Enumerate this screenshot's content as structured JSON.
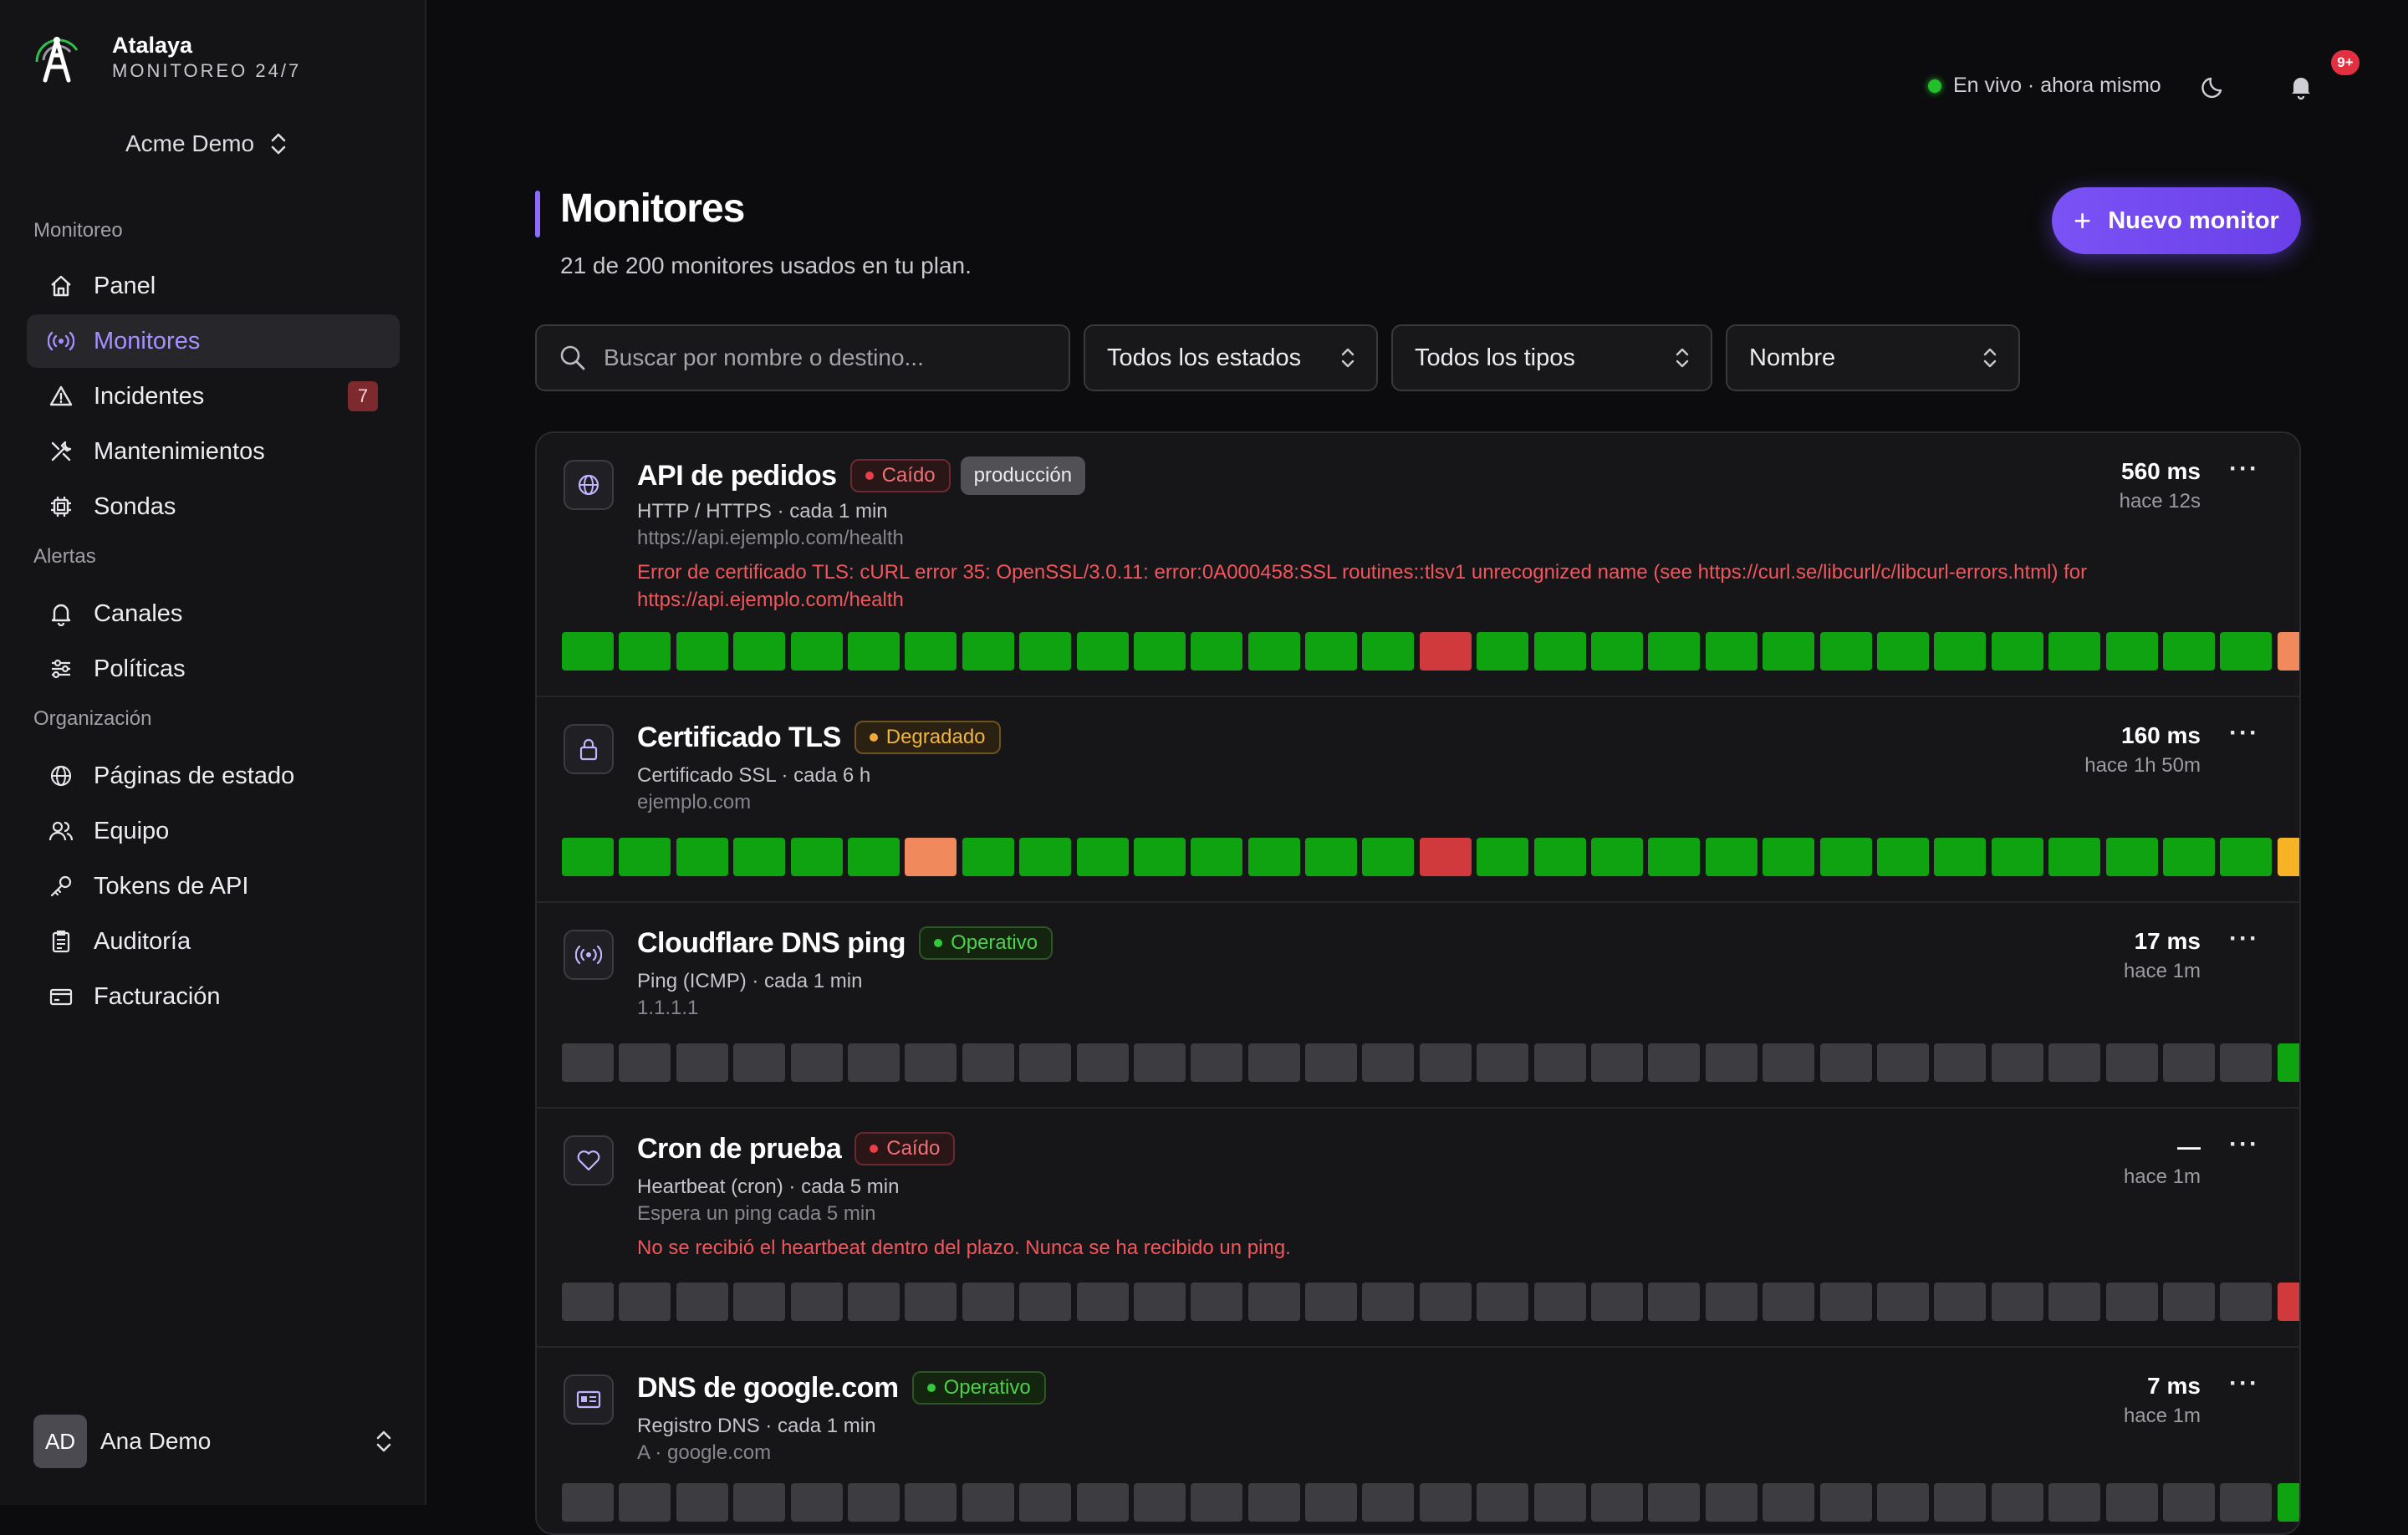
{
  "brand": {
    "name": "Atalaya",
    "subtitle": "MONITOREO 24/7"
  },
  "org": {
    "name": "Acme Demo"
  },
  "sidebar": {
    "sections": [
      {
        "label": "Monitoreo"
      },
      {
        "label": "Alertas"
      },
      {
        "label": "Organización"
      }
    ],
    "items": [
      {
        "label": "Panel",
        "icon": "home-icon"
      },
      {
        "label": "Monitores",
        "icon": "radio-icon",
        "active": true
      },
      {
        "label": "Incidentes",
        "icon": "warning-icon",
        "badge": "7"
      },
      {
        "label": "Mantenimientos",
        "icon": "tools-icon"
      },
      {
        "label": "Sondas",
        "icon": "chip-icon"
      },
      {
        "label": "Canales",
        "icon": "bell-icon"
      },
      {
        "label": "Políticas",
        "icon": "sliders-icon"
      },
      {
        "label": "Páginas de estado",
        "icon": "globe-icon"
      },
      {
        "label": "Equipo",
        "icon": "users-icon"
      },
      {
        "label": "Tokens de API",
        "icon": "key-icon"
      },
      {
        "label": "Auditoría",
        "icon": "clipboard-icon"
      },
      {
        "label": "Facturación",
        "icon": "card-icon"
      }
    ]
  },
  "user": {
    "initials": "AD",
    "name": "Ana Demo"
  },
  "topbar": {
    "live_text": "En vivo · ahora mismo",
    "notif_badge": "9+"
  },
  "page": {
    "title": "Monitores",
    "subtitle": "21 de 200 monitores usados en tu plan.",
    "new_button": "Nuevo monitor"
  },
  "filters": {
    "search_placeholder": "Buscar por nombre o destino...",
    "status": "Todos los estados",
    "type": "Todos los tipos",
    "sort": "Nombre"
  },
  "colors": {
    "accent": "#8b6cff",
    "up": "#0fa312",
    "down": "#d13a3c",
    "warn": "#f08a5d",
    "degraded": "#f5b325",
    "empty": "#3c3c41"
  },
  "monitors": [
    {
      "name": "API de pedidos",
      "status": "Caído",
      "status_kind": "down",
      "tag": "producción",
      "icon": "globe-icon",
      "meta": "HTTP / HTTPS · cada 1 min",
      "target": "https://api.ejemplo.com/health",
      "error": "Error de certificado TLS: cURL error 35: OpenSSL/3.0.11: error:0A000458:SSL routines::tlsv1 unrecognized name (see https://curl.se/libcurl/c/libcurl-errors.html) for https://api.ejemplo.com/health",
      "latency": "560 ms",
      "ago": "hace 12s",
      "bars": "uuuuuuuuuuuuuuudUUUUUUUUUUUUUUwdd"
    },
    {
      "name": "Certificado TLS",
      "status": "Degradado",
      "status_kind": "deg",
      "tag": "",
      "icon": "lock-icon",
      "meta": "Certificado SSL · cada 6 h",
      "target": "ejemplo.com",
      "error": "",
      "latency": "160 ms",
      "ago": "hace 1h 50m",
      "bars": "uuuuuuwuuuuuuuudUUUUUUUUUUUUUUyuu"
    },
    {
      "name": "Cloudflare DNS ping",
      "status": "Operativo",
      "status_kind": "ok",
      "tag": "",
      "icon": "radio-icon",
      "meta": "Ping (ICMP) · cada 1 min",
      "target": "1.1.1.1",
      "error": "",
      "latency": "17 ms",
      "ago": "hace 1m",
      "bars": "eeeeeeeeeeeeeeeeeeeeeeeeeeeeeeuuu"
    },
    {
      "name": "Cron de prueba",
      "status": "Caído",
      "status_kind": "down",
      "tag": "",
      "icon": "heart-icon",
      "meta": "Heartbeat (cron) · cada 5 min",
      "target": "Espera un ping cada 5 min",
      "error": "No se recibió el heartbeat dentro del plazo. Nunca se ha recibido un ping.",
      "latency": "—",
      "ago": "hace 1m",
      "bars": "eeeeeeeeeeeeeeeeeeeeeeeeeeeeeeddd"
    },
    {
      "name": "DNS de google.com",
      "status": "Operativo",
      "status_kind": "ok",
      "tag": "",
      "icon": "id-card-icon",
      "meta": "Registro DNS · cada 1 min",
      "target": "A · google.com",
      "error": "",
      "latency": "7 ms",
      "ago": "hace 1m",
      "bars": "eeeeeeeeeeeeeeeeeeeeeeeeeeeeeeuuu"
    }
  ]
}
